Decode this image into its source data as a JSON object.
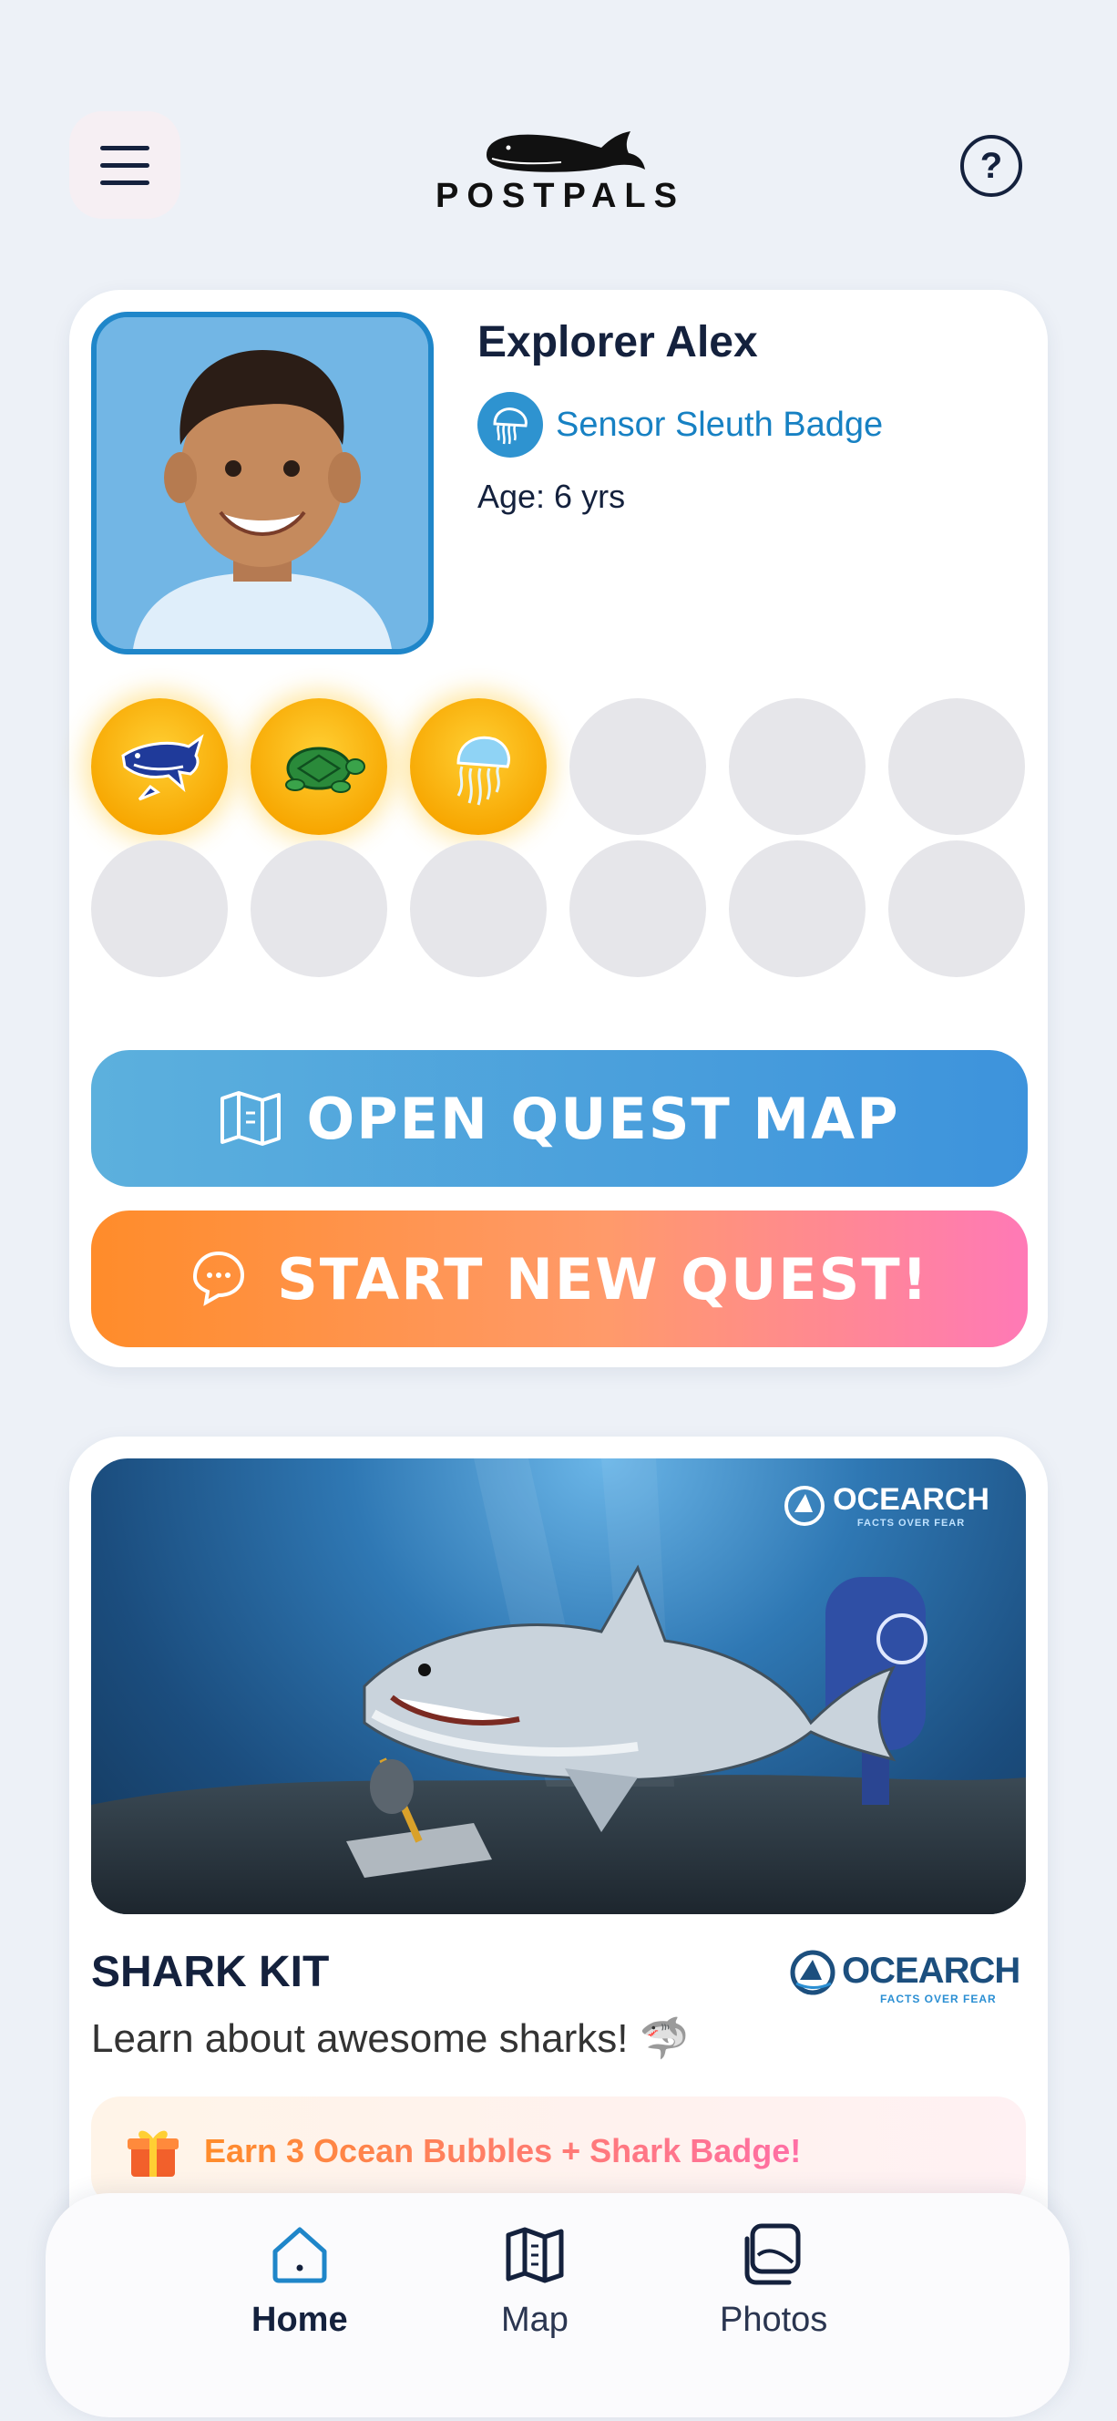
{
  "header": {
    "logo_text": "POSTPALS"
  },
  "profile": {
    "name": "Explorer Alex",
    "badge_name": "Sensor Sleuth Badge",
    "age": "Age: 6 yrs",
    "bubbles": [
      {
        "earned": true,
        "icon": "shark-icon"
      },
      {
        "earned": true,
        "icon": "turtle-icon"
      },
      {
        "earned": true,
        "icon": "jellyfish-icon"
      },
      {
        "earned": false
      },
      {
        "earned": false
      },
      {
        "earned": false
      },
      {
        "earned": false
      },
      {
        "earned": false
      },
      {
        "earned": false
      },
      {
        "earned": false
      },
      {
        "earned": false
      },
      {
        "earned": false
      }
    ],
    "open_map_label": "OPEN QUEST MAP",
    "start_quest_label": "START NEW QUEST!"
  },
  "kit": {
    "image_brand": "OCEARCH",
    "image_tagline": "FACTS OVER FEAR",
    "title": "SHARK KIT",
    "partner_name": "OCEARCH",
    "partner_tagline": "FACTS OVER FEAR",
    "description": "Learn about awesome sharks! 🦈",
    "reward": "Earn 3 Ocean Bubbles + Shark Badge!"
  },
  "nav": {
    "home": "Home",
    "map": "Map",
    "photos": "Photos"
  },
  "colors": {
    "accent_blue": "#1f86c9",
    "gold": "#f7a600",
    "orange": "#ff8c2a",
    "pink": "#ff79b6"
  }
}
